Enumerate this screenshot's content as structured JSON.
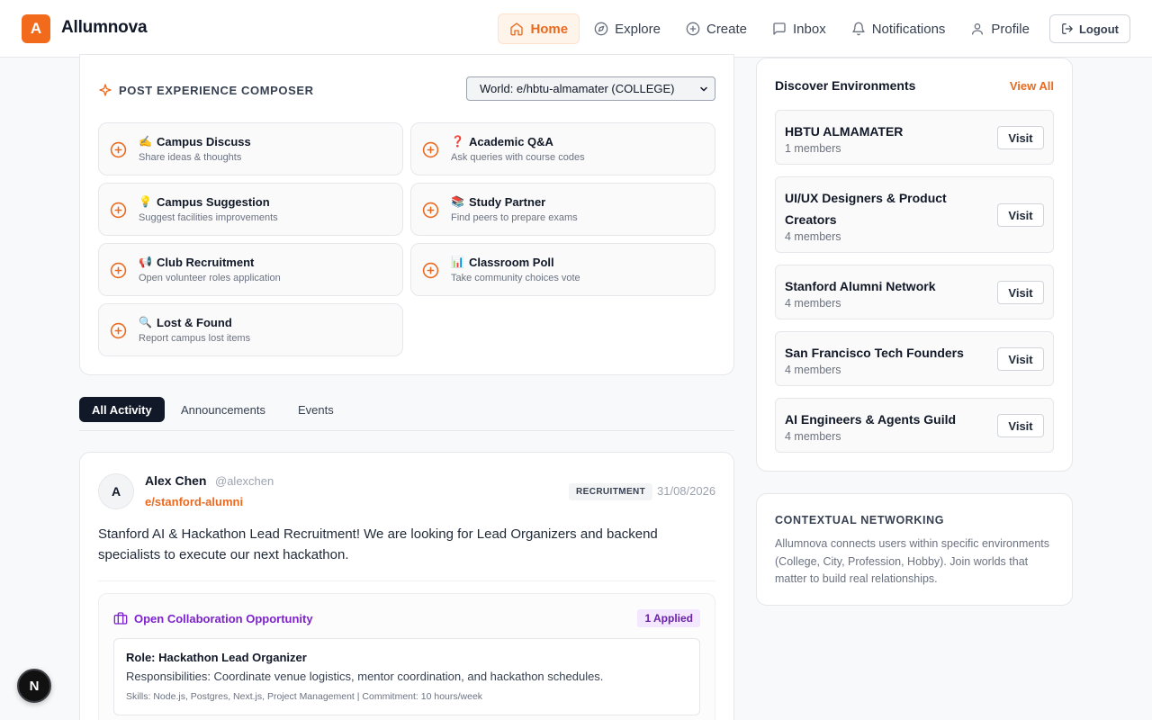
{
  "brand": {
    "logo_letter": "A",
    "name": "Allumnova",
    "accent": "#f26a1b"
  },
  "nav": {
    "items": [
      {
        "label": "Home",
        "icon": "home-icon",
        "active": true
      },
      {
        "label": "Explore",
        "icon": "compass-icon"
      },
      {
        "label": "Create",
        "icon": "plus-circle-icon"
      },
      {
        "label": "Inbox",
        "icon": "chat-icon"
      },
      {
        "label": "Notifications",
        "icon": "bell-icon"
      },
      {
        "label": "Profile",
        "icon": "user-icon"
      }
    ],
    "logout_label": "Logout"
  },
  "composer": {
    "title": "POST EXPERIENCE COMPOSER",
    "world_select": "World: e/hbtu-almamater (COLLEGE)",
    "options": [
      {
        "emoji": "✍️",
        "title": "Campus Discuss",
        "sub": "Share ideas & thoughts"
      },
      {
        "emoji": "❓",
        "title": "Academic Q&A",
        "sub": "Ask queries with course codes"
      },
      {
        "emoji": "💡",
        "title": "Campus Suggestion",
        "sub": "Suggest facilities improvements"
      },
      {
        "emoji": "📚",
        "title": "Study Partner",
        "sub": "Find peers to prepare exams"
      },
      {
        "emoji": "📢",
        "title": "Club Recruitment",
        "sub": "Open volunteer roles application"
      },
      {
        "emoji": "📊",
        "title": "Classroom Poll",
        "sub": "Take community choices vote"
      },
      {
        "emoji": "🔍",
        "title": "Lost & Found",
        "sub": "Report campus lost items"
      }
    ]
  },
  "tabs": [
    {
      "label": "All Activity",
      "active": true
    },
    {
      "label": "Announcements"
    },
    {
      "label": "Events"
    }
  ],
  "post": {
    "avatar": "A",
    "name": "Alex Chen",
    "handle": "@alexchen",
    "environment": "e/stanford-alumni",
    "badge": "RECRUITMENT",
    "date": "31/08/2026",
    "body": "Stanford AI & Hackathon Lead Recruitment! We are looking for Lead Organizers and backend specialists to execute our next hackathon.",
    "collab": {
      "title": "Open Collaboration Opportunity",
      "applied": "1 Applied",
      "role": "Role: Hackathon Lead Organizer",
      "responsibilities": "Responsibilities: Coordinate venue logistics, mentor coordination, and hackathon schedules.",
      "skills": "Skills: Node.js, Postgres, Next.js, Project Management | Commitment: 10 hours/week"
    }
  },
  "discover": {
    "title": "Discover Environments",
    "view_all": "View All",
    "visit_label": "Visit",
    "items": [
      {
        "name": "HBTU ALMAMATER",
        "members": "1 members"
      },
      {
        "name": "UI/UX Designers & Product Creators",
        "members": "4 members"
      },
      {
        "name": "Stanford Alumni Network",
        "members": "4 members"
      },
      {
        "name": "San Francisco Tech Founders",
        "members": "4 members"
      },
      {
        "name": "AI Engineers & Agents Guild",
        "members": "4 members"
      }
    ]
  },
  "contextual": {
    "title": "CONTEXTUAL NETWORKING",
    "body": "Allumnova connects users within specific environments (College, City, Profession, Hobby). Join worlds that matter to build real relationships."
  },
  "devtools": {
    "label": "N"
  }
}
